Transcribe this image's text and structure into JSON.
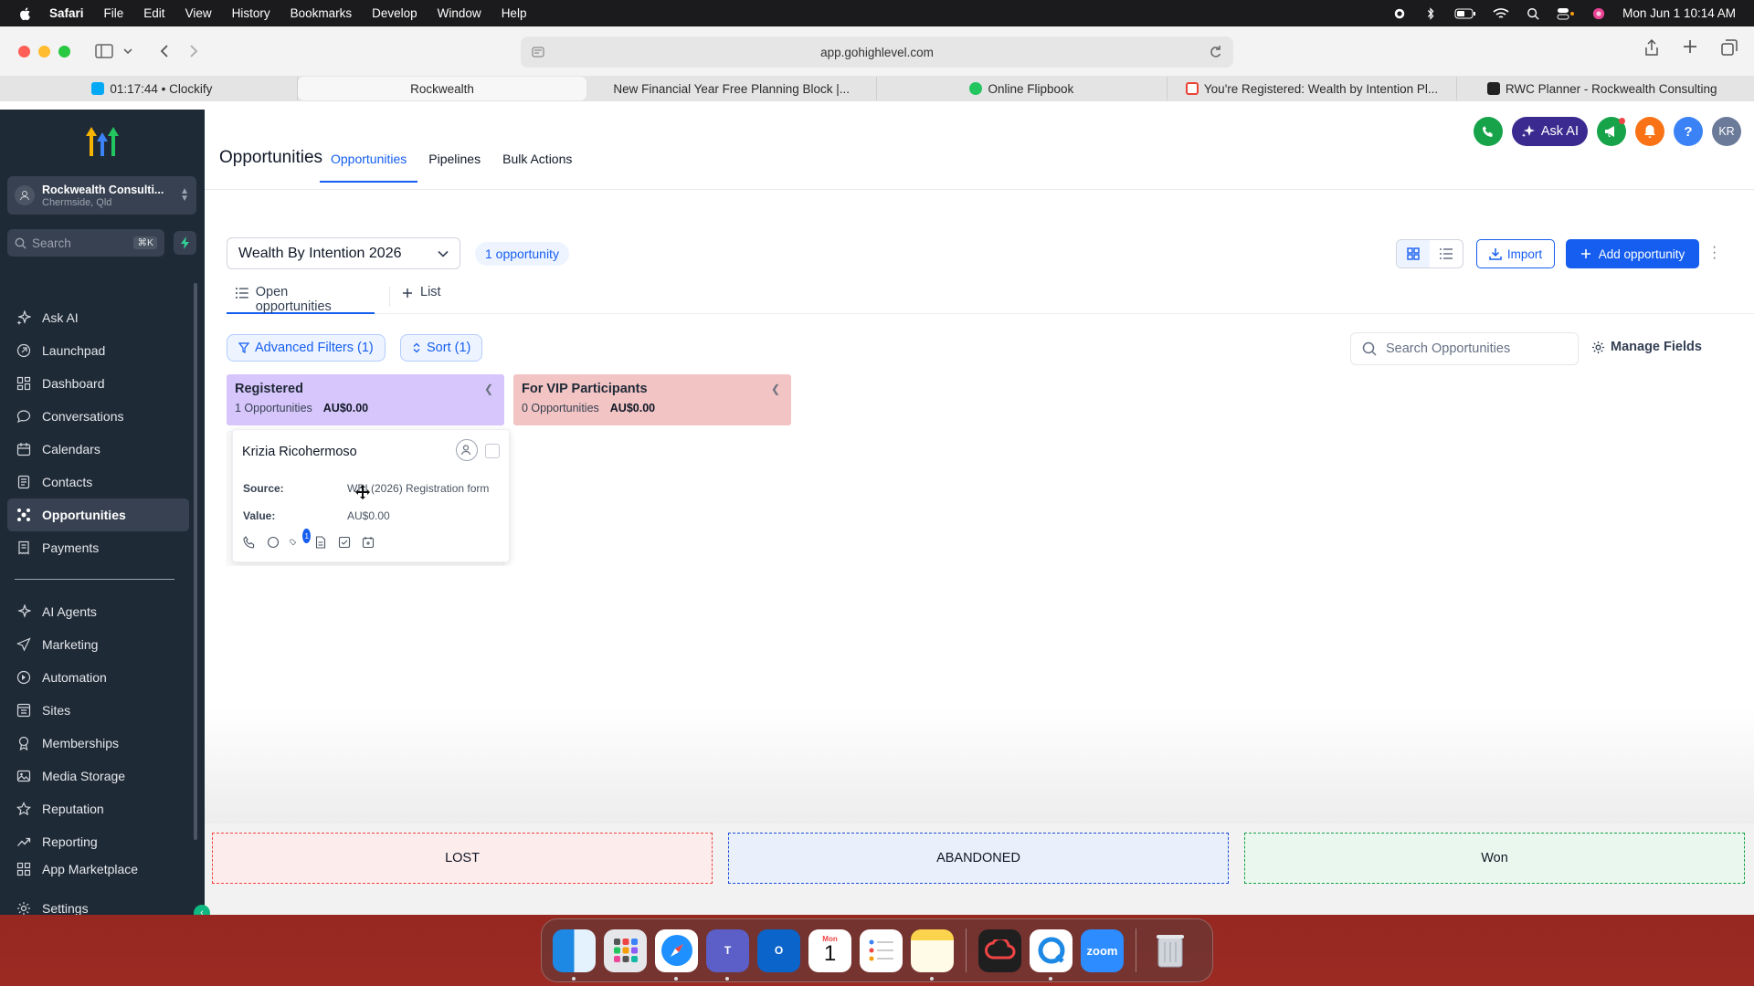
{
  "menubar": {
    "app": "Safari",
    "items": [
      "File",
      "Edit",
      "View",
      "History",
      "Bookmarks",
      "Develop",
      "Window",
      "Help"
    ],
    "datetime": "Mon Jun 1  10:14 AM"
  },
  "browser": {
    "url": "app.gohighlevel.com",
    "tabs": [
      {
        "label": "01:17:44 • Clockify",
        "color": "#03a9f4"
      },
      {
        "label": "Rockwealth",
        "color": ""
      },
      {
        "label": "New Financial Year Free Planning Block |...",
        "color": ""
      },
      {
        "label": "Online Flipbook",
        "color": "#22c55e"
      },
      {
        "label": "You're Registered: Wealth by Intention Pl...",
        "color": "#ea4335"
      },
      {
        "label": "RWC Planner - Rockwealth Consulting",
        "color": "#222222"
      }
    ]
  },
  "sidebar": {
    "account_name": "Rockwealth Consulti...",
    "account_location": "Chermside, Qld",
    "search_placeholder": "Search",
    "search_shortcut": "⌘K",
    "items": [
      {
        "label": "Ask AI",
        "icon": "sparkle-icon"
      },
      {
        "label": "Launchpad",
        "icon": "rocket-icon"
      },
      {
        "label": "Dashboard",
        "icon": "grid-icon"
      },
      {
        "label": "Conversations",
        "icon": "chat-icon"
      },
      {
        "label": "Calendars",
        "icon": "calendar-icon"
      },
      {
        "label": "Contacts",
        "icon": "contacts-icon"
      },
      {
        "label": "Opportunities",
        "icon": "opportunities-icon"
      },
      {
        "label": "Payments",
        "icon": "receipt-icon"
      }
    ],
    "items2": [
      {
        "label": "AI Agents",
        "icon": "sparkle-icon"
      },
      {
        "label": "Marketing",
        "icon": "send-icon"
      },
      {
        "label": "Automation",
        "icon": "automation-icon"
      },
      {
        "label": "Sites",
        "icon": "sites-icon"
      },
      {
        "label": "Memberships",
        "icon": "membership-icon"
      },
      {
        "label": "Media Storage",
        "icon": "media-icon"
      },
      {
        "label": "Reputation",
        "icon": "star-icon"
      },
      {
        "label": "Reporting",
        "icon": "trend-icon"
      },
      {
        "label": "App Marketplace",
        "icon": "marketplace-icon"
      }
    ],
    "settings_label": "Settings"
  },
  "header": {
    "title": "Opportunities",
    "tabs": [
      "Opportunities",
      "Pipelines",
      "Bulk Actions"
    ],
    "ask_ai": "Ask AI",
    "help": "?",
    "avatar": "KR"
  },
  "controls": {
    "pipeline": "Wealth By Intention 2026",
    "count": "1 opportunity",
    "import": "Import",
    "add": "Add opportunity"
  },
  "subtabs": {
    "open": "Open opportunities",
    "list": "List"
  },
  "filters": {
    "advanced": "Advanced Filters (1)",
    "sort": "Sort (1)",
    "search_placeholder": "Search Opportunities",
    "manage_fields": "Manage Fields"
  },
  "columns": [
    {
      "title": "Registered",
      "count": "1 Opportunities",
      "amount": "AU$0.00",
      "color": "#d6c6fb"
    },
    {
      "title": "For VIP Participants",
      "count": "0 Opportunities",
      "amount": "AU$0.00",
      "color": "#f2c4c4"
    }
  ],
  "card": {
    "name": "Krizia Ricohermoso",
    "source_label": "Source:",
    "source_value": "WBI (2026) Registration form",
    "value_label": "Value:",
    "value_value": "AU$0.00",
    "task_badge": "1"
  },
  "dropzones": {
    "lost": "LOST",
    "abandoned": "ABANDONED",
    "won": "Won"
  },
  "dock": {
    "calendar_month": "Mon",
    "calendar_day": "1",
    "zoom": "zoom"
  }
}
